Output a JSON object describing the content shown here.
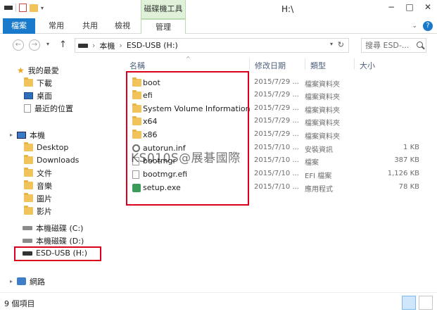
{
  "window": {
    "title": "H:\\",
    "context_tab_header": "磁碟機工具",
    "buttons": [
      "−",
      "□",
      "✕"
    ]
  },
  "ribbon": {
    "tabs": [
      {
        "label": "檔案"
      },
      {
        "label": "常用"
      },
      {
        "label": "共用"
      },
      {
        "label": "檢視"
      },
      {
        "label": "管理"
      }
    ]
  },
  "address": {
    "back": "←",
    "forward": "→",
    "up": "↑",
    "path_pc": "本機",
    "path_sep": "›",
    "path_drive": "ESD-USB (H:)",
    "refresh": "↻",
    "search_placeholder": "搜尋 ESD-..."
  },
  "nav": {
    "favorites": "我的最愛",
    "downloads": "下載",
    "desktop_fav": "桌面",
    "recent": "最近的位置",
    "this_pc": "本機",
    "desktop": "Desktop",
    "downloads2": "Downloads",
    "documents": "文件",
    "music": "音樂",
    "pictures": "圖片",
    "videos": "影片",
    "drive_c": "本機磁碟 (C:)",
    "drive_d": "本機磁碟 (D:)",
    "drive_h": "ESD-USB (H:)",
    "network": "網路"
  },
  "columns": {
    "name": "名稱",
    "date": "修改日期",
    "type": "類型",
    "size": "大小"
  },
  "files": [
    {
      "name": "boot",
      "date": "2015/7/29 ...",
      "type": "檔案資料夾",
      "size": "",
      "icon": "folder-icon"
    },
    {
      "name": "efi",
      "date": "2015/7/29 ...",
      "type": "檔案資料夾",
      "size": "",
      "icon": "folder-icon"
    },
    {
      "name": "System Volume Information",
      "date": "2015/7/29 ...",
      "type": "檔案資料夾",
      "size": "",
      "icon": "folder-icon"
    },
    {
      "name": "x64",
      "date": "2015/7/29 ...",
      "type": "檔案資料夾",
      "size": "",
      "icon": "folder-icon"
    },
    {
      "name": "x86",
      "date": "2015/7/29 ...",
      "type": "檔案資料夾",
      "size": "",
      "icon": "folder-icon"
    },
    {
      "name": "autorun.inf",
      "date": "2015/7/10 ...",
      "type": "安裝資訊",
      "size": "1 KB",
      "icon": "gear-icon"
    },
    {
      "name": "bootmgr",
      "date": "2015/7/10 ...",
      "type": "檔案",
      "size": "387 KB",
      "icon": "file-icon"
    },
    {
      "name": "bootmgr.efi",
      "date": "2015/7/10 ...",
      "type": "EFI 檔案",
      "size": "1,126 KB",
      "icon": "file-icon"
    },
    {
      "name": "setup.exe",
      "date": "2015/7/10 ...",
      "type": "應用程式",
      "size": "78 KB",
      "icon": "setup-icon"
    }
  ],
  "watermark": "KS010S@展碁國際",
  "status": {
    "item_count": "9 個項目"
  }
}
